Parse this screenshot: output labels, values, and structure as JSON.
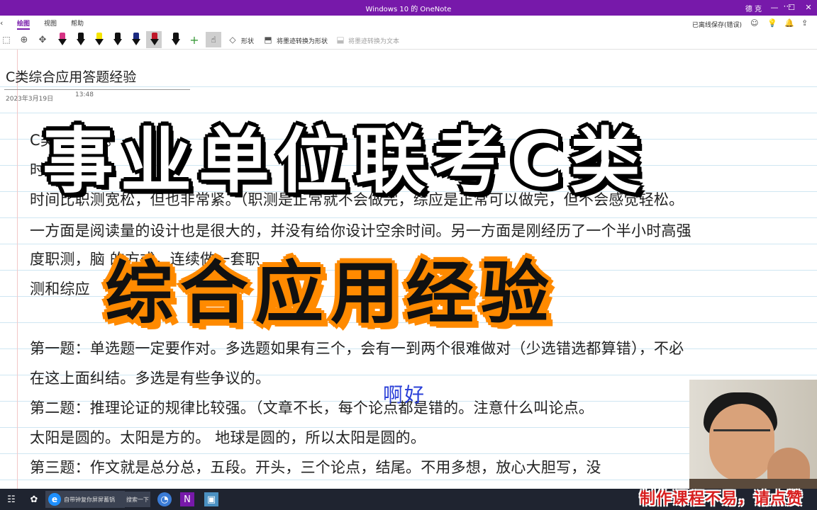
{
  "window": {
    "title": "Windows 10 的 OneNote",
    "user": "德 克",
    "more": "···",
    "controls": [
      "—",
      "☐",
      "✕"
    ]
  },
  "tabs": {
    "draw": "绘图",
    "view": "视图",
    "help": "帮助"
  },
  "status": {
    "saved": "已离线保存(错误)"
  },
  "ribbon": {
    "shapes_label": "形状",
    "ink_to_shape_label": "将墨迹转换为形状",
    "ink_to_text_label": "将墨迹转换为文本",
    "pen_colors": [
      "#d63384",
      "#111111",
      "#f5e400",
      "#111111",
      "#1b2a80",
      "#c0182a",
      "#111111"
    ]
  },
  "page": {
    "title": "C类综合应用答题经验",
    "date": "2023年3月19日",
    "time": "13:48",
    "lines": [
      "C类                                                                                                     直作文。",
      "时",
      "时间比职测宽松，但也非常紧。（职测是正常就不会做完，综应是正常可以做完，但不会感觉轻松。",
      "一方面是阅读量的设计也是很大的，并没有给你设计空余时间。另一方面是刚经历了一个半小时高强",
      "度职测，脑                                                                        的方式，连续做一套职",
      "测和综应",
      "",
      "第一题：单选题一定要作对。多选题如果有三个，会有一到两个很难做对（少选错选都算错），不必",
      "在这上面纠结。多选是有些争议的。",
      "第二题：推理论证的规律比较强。（文章不长，每个论点都是错的。注意什么叫论点。",
      "太阳是圆的。太阳是方的。   地球是圆的，所以太阳是圆的。",
      "第三题：作文就是总分总，五段。开头，三个论点，结尾。不用多想，放心大胆写，没"
    ],
    "handwriting": "啊好"
  },
  "overlay": {
    "headline": "事业单位联考C类",
    "subheadline": "综合应用经验",
    "promo": "制作课程不易，请点赞"
  },
  "taskbar": {
    "ie_label": "自带钟复你屏屏蓄锅",
    "search_label": "搜索一下"
  }
}
